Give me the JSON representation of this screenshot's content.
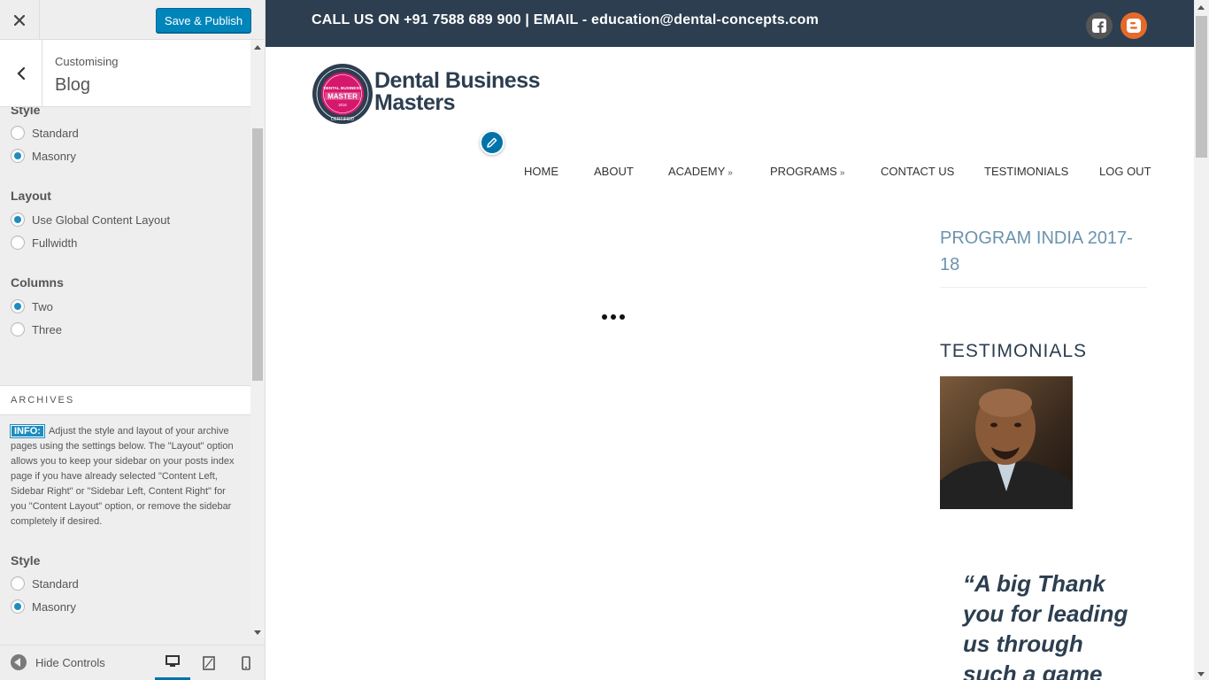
{
  "customizer": {
    "close_icon": "close-icon",
    "save_label": "Save & Publish",
    "section_sub": "Customising",
    "section_name": "Blog",
    "partial_text": "",
    "blog": {
      "style_title": "Style",
      "style_options": [
        "Standard",
        "Masonry"
      ],
      "style_selected": "Masonry",
      "layout_title": "Layout",
      "layout_options": [
        "Use Global Content Layout",
        "Fullwidth"
      ],
      "layout_selected": "Use Global Content Layout",
      "columns_title": "Columns",
      "columns_options": [
        "Two",
        "Three"
      ],
      "columns_selected": "Two"
    },
    "archives": {
      "heading": "ARCHIVES",
      "info_badge": "INFO:",
      "info_text": "Adjust the style and layout of your archive pages using the settings below. The \"Layout\" option allows you to keep your sidebar on your posts index page if you have already selected \"Content Left, Sidebar Right\" or \"Sidebar Left, Content Right\" for you \"Content Layout\" option, or remove the sidebar completely if desired.",
      "style_title": "Style",
      "style_options": [
        "Standard",
        "Masonry"
      ],
      "style_selected": "Masonry"
    },
    "footer": {
      "hide_controls": "Hide Controls",
      "devices": [
        "desktop-icon",
        "tablet-icon",
        "mobile-icon"
      ],
      "active_device": "desktop"
    }
  },
  "site": {
    "topbar_text": "CALL US ON +91 7588 689 900 | EMAIL - education@dental-concepts.com",
    "topbar_color": "#2c3e50",
    "social": [
      "facebook-icon",
      "blogger-icon"
    ],
    "logo": {
      "line1": "Dental Business",
      "line2": "Masters",
      "badge_line1": "DENTAL BUSINESS",
      "badge_line2": "MASTER",
      "badge_year": "2016",
      "badge_bottom": "CERTIFIED"
    },
    "nav": [
      "HOME",
      "ABOUT",
      "ACADEMY",
      "PROGRAMS",
      "CONTACT US",
      "TESTIMONIALS",
      "LOG OUT"
    ],
    "sidebar": {
      "widget1_title": "PROGRAM INDIA 2017-18",
      "widget2_title": "TESTIMONIALS",
      "quote": "“A big Thank you for leading us through such a game"
    },
    "accent_color": "#6b93ad",
    "brand_pink": "#d6186d"
  }
}
